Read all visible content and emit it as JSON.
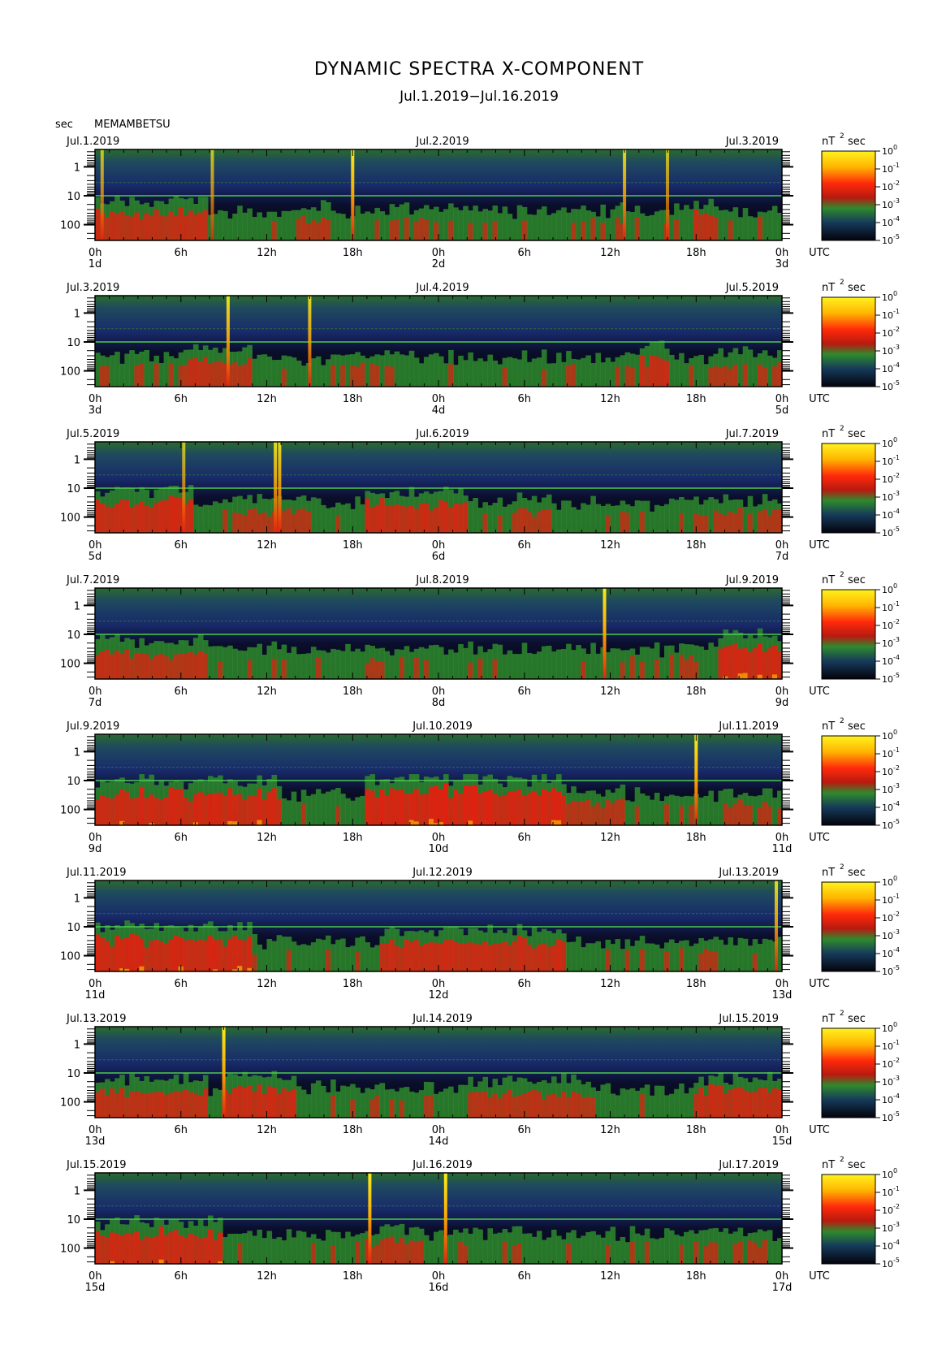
{
  "title": "DYNAMIC SPECTRA X-COMPONENT",
  "subtitle": "Jul.1.2019−Jul.16.2019",
  "station": "MEMAMBETSU",
  "y_unit": "sec",
  "colorbar_unit": "nT",
  "colorbar_unit_exp": "2",
  "colorbar_unit_suffix": "sec",
  "utc_label": "UTC",
  "colors": {
    "background": "#050514",
    "navy": "#1a2a6a",
    "green": "#2e8a2e",
    "red": "#e61e10",
    "yellow": "#ffe81a",
    "hline": "#4fc94f"
  },
  "chart_data": [
    {
      "type": "heatmap",
      "left_date": "Jul.1.2019",
      "mid_date": "Jul.2.2019",
      "right_date": "Jul.3.2019",
      "ytick_labels": [
        "1",
        "10",
        "100"
      ],
      "yticks": [
        1,
        10,
        100
      ],
      "ylim": [
        0.25,
        350
      ],
      "log_y": true,
      "xticks": [
        0,
        6,
        12,
        18,
        24,
        30,
        36,
        42,
        48
      ],
      "xtick_labels": [
        "0h",
        "6h",
        "12h",
        "18h",
        "0h",
        "6h",
        "12h",
        "18h",
        "0h"
      ],
      "day_labels": [
        "1d",
        "2d",
        "3d"
      ],
      "xlim_hours": [
        0,
        48
      ],
      "colorbar_ticks": [
        "10^0",
        "10^-1",
        "10^-2",
        "10^-3",
        "10^-4",
        "10^-5"
      ],
      "colorbar_range": [
        -5,
        0
      ],
      "spikes": [
        {
          "t": 0.5,
          "i": 0.72
        },
        {
          "t": 8.2,
          "i": 0.72
        },
        {
          "t": 18.0,
          "i": 0.97
        },
        {
          "t": 37.0,
          "i": 0.85
        },
        {
          "t": 40.0,
          "i": 0.72
        }
      ],
      "bursts": [
        {
          "t0": 0,
          "t1": 8,
          "a": 0.75
        },
        {
          "t0": 14,
          "t1": 16,
          "a": 0.6
        },
        {
          "t0": 33,
          "t1": 35,
          "a": 0.45
        },
        {
          "t0": 42,
          "t1": 43.5,
          "a": 0.7
        }
      ]
    },
    {
      "type": "heatmap",
      "left_date": "Jul.3.2019",
      "mid_date": "Jul.4.2019",
      "right_date": "Jul.5.2019",
      "ytick_labels": [
        "1",
        "10",
        "100"
      ],
      "yticks": [
        1,
        10,
        100
      ],
      "ylim": [
        0.25,
        350
      ],
      "log_y": true,
      "xticks": [
        0,
        6,
        12,
        18,
        24,
        30,
        36,
        42,
        48
      ],
      "xtick_labels": [
        "0h",
        "6h",
        "12h",
        "18h",
        "0h",
        "6h",
        "12h",
        "18h",
        "0h"
      ],
      "day_labels": [
        "3d",
        "4d",
        "5d"
      ],
      "xlim_hours": [
        0,
        48
      ],
      "colorbar_ticks": [
        "10^0",
        "10^-1",
        "10^-2",
        "10^-3",
        "10^-4",
        "10^-5"
      ],
      "colorbar_range": [
        -5,
        0
      ],
      "spikes": [
        {
          "t": 9.3,
          "i": 0.9
        },
        {
          "t": 15.0,
          "i": 0.85
        }
      ],
      "bursts": [
        {
          "t0": 6,
          "t1": 11,
          "a": 0.7
        },
        {
          "t0": 17,
          "t1": 19,
          "a": 0.5
        },
        {
          "t0": 38,
          "t1": 40,
          "a": 0.75
        },
        {
          "t0": 43,
          "t1": 48,
          "a": 0.55
        }
      ]
    },
    {
      "type": "heatmap",
      "left_date": "Jul.5.2019",
      "mid_date": "Jul.6.2019",
      "right_date": "Jul.7.2019",
      "ytick_labels": [
        "1",
        "10",
        "100"
      ],
      "yticks": [
        1,
        10,
        100
      ],
      "ylim": [
        0.25,
        350
      ],
      "log_y": true,
      "xticks": [
        0,
        6,
        12,
        18,
        24,
        30,
        36,
        42,
        48
      ],
      "xtick_labels": [
        "0h",
        "6h",
        "12h",
        "18h",
        "0h",
        "6h",
        "12h",
        "18h",
        "0h"
      ],
      "day_labels": [
        "5d",
        "6d",
        "7d"
      ],
      "xlim_hours": [
        0,
        48
      ],
      "colorbar_ticks": [
        "10^0",
        "10^-1",
        "10^-2",
        "10^-3",
        "10^-4",
        "10^-5"
      ],
      "colorbar_range": [
        -5,
        0
      ],
      "spikes": [
        {
          "t": 6.2,
          "i": 0.72
        },
        {
          "t": 12.6,
          "i": 0.85
        },
        {
          "t": 12.9,
          "i": 0.85
        }
      ],
      "bursts": [
        {
          "t0": 0,
          "t1": 7,
          "a": 0.85
        },
        {
          "t0": 9,
          "t1": 15,
          "a": 0.55
        },
        {
          "t0": 19,
          "t1": 26,
          "a": 0.8
        },
        {
          "t0": 29,
          "t1": 32,
          "a": 0.6
        },
        {
          "t0": 42,
          "t1": 48,
          "a": 0.5
        }
      ]
    },
    {
      "type": "heatmap",
      "left_date": "Jul.7.2019",
      "mid_date": "Jul.8.2019",
      "right_date": "Jul.9.2019",
      "ytick_labels": [
        "1",
        "10",
        "100"
      ],
      "yticks": [
        1,
        10,
        100
      ],
      "ylim": [
        0.25,
        350
      ],
      "log_y": true,
      "xticks": [
        0,
        6,
        12,
        18,
        24,
        30,
        36,
        42,
        48
      ],
      "xtick_labels": [
        "0h",
        "6h",
        "12h",
        "18h",
        "0h",
        "6h",
        "12h",
        "18h",
        "0h"
      ],
      "day_labels": [
        "7d",
        "8d",
        "9d"
      ],
      "xlim_hours": [
        0,
        48
      ],
      "colorbar_ticks": [
        "10^0",
        "10^-1",
        "10^-2",
        "10^-3",
        "10^-4",
        "10^-5"
      ],
      "colorbar_range": [
        -5,
        0
      ],
      "spikes": [
        {
          "t": 35.6,
          "i": 0.97
        }
      ],
      "bursts": [
        {
          "t0": 0,
          "t1": 8,
          "a": 0.7
        },
        {
          "t0": 21,
          "t1": 27,
          "a": 0.45
        },
        {
          "t0": 40,
          "t1": 42,
          "a": 0.5
        },
        {
          "t0": 43.5,
          "t1": 48,
          "a": 0.95
        }
      ]
    },
    {
      "type": "heatmap",
      "left_date": "Jul.9.2019",
      "mid_date": "Jul.10.2019",
      "right_date": "Jul.11.2019",
      "ytick_labels": [
        "1",
        "10",
        "100"
      ],
      "yticks": [
        1,
        10,
        100
      ],
      "ylim": [
        0.25,
        350
      ],
      "log_y": true,
      "xticks": [
        0,
        6,
        12,
        18,
        24,
        30,
        36,
        42,
        48
      ],
      "xtick_labels": [
        "0h",
        "6h",
        "12h",
        "18h",
        "0h",
        "6h",
        "12h",
        "18h",
        "0h"
      ],
      "day_labels": [
        "9d",
        "10d",
        "11d"
      ],
      "xlim_hours": [
        0,
        48
      ],
      "colorbar_ticks": [
        "10^0",
        "10^-1",
        "10^-2",
        "10^-3",
        "10^-4",
        "10^-5"
      ],
      "colorbar_range": [
        -5,
        0
      ],
      "spikes": [
        {
          "t": 42.0,
          "i": 0.97
        }
      ],
      "bursts": [
        {
          "t0": 0,
          "t1": 13,
          "a": 0.9
        },
        {
          "t0": 19,
          "t1": 33,
          "a": 1.0
        },
        {
          "t0": 33,
          "t1": 37,
          "a": 0.6
        },
        {
          "t0": 44,
          "t1": 48,
          "a": 0.55
        }
      ]
    },
    {
      "type": "heatmap",
      "left_date": "Jul.11.2019",
      "mid_date": "Jul.12.2019",
      "right_date": "Jul.13.2019",
      "ytick_labels": [
        "1",
        "10",
        "100"
      ],
      "yticks": [
        1,
        10,
        100
      ],
      "ylim": [
        0.25,
        350
      ],
      "log_y": true,
      "xticks": [
        0,
        6,
        12,
        18,
        24,
        30,
        36,
        42,
        48
      ],
      "xtick_labels": [
        "0h",
        "6h",
        "12h",
        "18h",
        "0h",
        "6h",
        "12h",
        "18h",
        "0h"
      ],
      "day_labels": [
        "11d",
        "12d",
        "13d"
      ],
      "xlim_hours": [
        0,
        48
      ],
      "colorbar_ticks": [
        "10^0",
        "10^-1",
        "10^-2",
        "10^-3",
        "10^-4",
        "10^-5"
      ],
      "colorbar_range": [
        -5,
        0
      ],
      "spikes": [
        {
          "t": 47.6,
          "i": 0.85
        }
      ],
      "bursts": [
        {
          "t0": 0,
          "t1": 11,
          "a": 0.9
        },
        {
          "t0": 20,
          "t1": 33,
          "a": 0.8
        },
        {
          "t0": 42,
          "t1": 48,
          "a": 0.45
        }
      ]
    },
    {
      "type": "heatmap",
      "left_date": "Jul.13.2019",
      "mid_date": "Jul.14.2019",
      "right_date": "Jul.15.2019",
      "ytick_labels": [
        "1",
        "10",
        "100"
      ],
      "yticks": [
        1,
        10,
        100
      ],
      "ylim": [
        0.25,
        350
      ],
      "log_y": true,
      "xticks": [
        0,
        6,
        12,
        18,
        24,
        30,
        36,
        42,
        48
      ],
      "xtick_labels": [
        "0h",
        "6h",
        "12h",
        "18h",
        "0h",
        "6h",
        "12h",
        "18h",
        "0h"
      ],
      "day_labels": [
        "13d",
        "14d",
        "15d"
      ],
      "xlim_hours": [
        0,
        48
      ],
      "colorbar_ticks": [
        "10^0",
        "10^-1",
        "10^-2",
        "10^-3",
        "10^-4",
        "10^-5"
      ],
      "colorbar_range": [
        -5,
        0
      ],
      "spikes": [
        {
          "t": 9.0,
          "i": 0.97
        }
      ],
      "bursts": [
        {
          "t0": 0,
          "t1": 8,
          "a": 0.7
        },
        {
          "t0": 9,
          "t1": 14,
          "a": 0.85
        },
        {
          "t0": 26,
          "t1": 35,
          "a": 0.65
        },
        {
          "t0": 42,
          "t1": 48,
          "a": 0.75
        }
      ]
    },
    {
      "type": "heatmap",
      "left_date": "Jul.15.2019",
      "mid_date": "Jul.16.2019",
      "right_date": "Jul.17.2019",
      "ytick_labels": [
        "1",
        "10",
        "100"
      ],
      "yticks": [
        1,
        10,
        100
      ],
      "ylim": [
        0.25,
        350
      ],
      "log_y": true,
      "xticks": [
        0,
        6,
        12,
        18,
        24,
        30,
        36,
        42,
        48
      ],
      "xtick_labels": [
        "0h",
        "6h",
        "12h",
        "18h",
        "0h",
        "6h",
        "12h",
        "18h",
        "0h"
      ],
      "day_labels": [
        "15d",
        "16d",
        "17d"
      ],
      "xlim_hours": [
        0,
        48
      ],
      "colorbar_ticks": [
        "10^0",
        "10^-1",
        "10^-2",
        "10^-3",
        "10^-4",
        "10^-5"
      ],
      "colorbar_range": [
        -5,
        0
      ],
      "spikes": [
        {
          "t": 19.2,
          "i": 0.97
        },
        {
          "t": 24.5,
          "i": 0.97
        }
      ],
      "bursts": [
        {
          "t0": 0,
          "t1": 9,
          "a": 0.85
        },
        {
          "t0": 19,
          "t1": 23,
          "a": 0.6
        },
        {
          "t0": 24,
          "t1": 27,
          "a": 0.5
        },
        {
          "t0": 40,
          "t1": 47,
          "a": 0.5
        }
      ]
    }
  ]
}
